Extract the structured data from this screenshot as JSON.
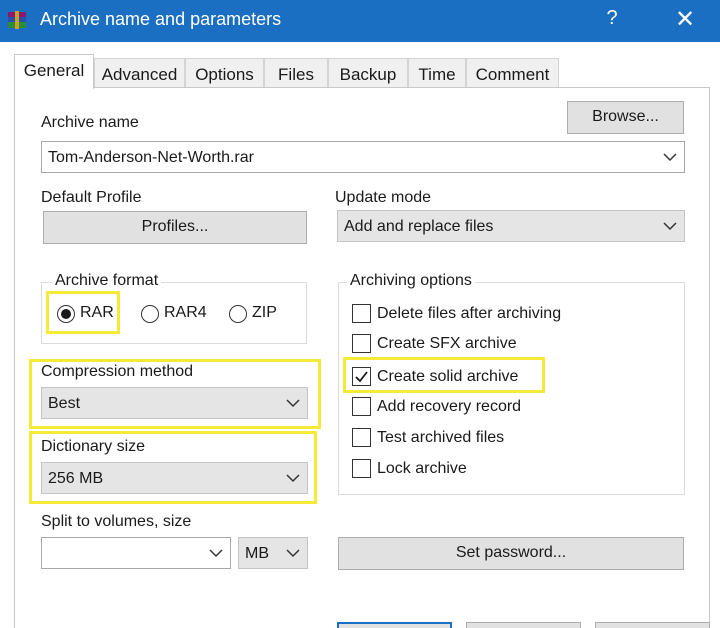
{
  "window": {
    "title": "Archive name and parameters",
    "help": "?",
    "close": "✕"
  },
  "tabs": [
    "General",
    "Advanced",
    "Options",
    "Files",
    "Backup",
    "Time",
    "Comment"
  ],
  "archive_name": {
    "label": "Archive name",
    "value": "Tom-Anderson-Net-Worth.rar",
    "browse": "Browse..."
  },
  "profile": {
    "label": "Default Profile",
    "button": "Profiles..."
  },
  "update_mode": {
    "label": "Update mode",
    "value": "Add and replace files"
  },
  "archive_format": {
    "label": "Archive format",
    "options": [
      "RAR",
      "RAR4",
      "ZIP"
    ],
    "selected": "RAR"
  },
  "compression": {
    "label": "Compression method",
    "value": "Best"
  },
  "dictionary": {
    "label": "Dictionary size",
    "value": "256 MB"
  },
  "split": {
    "label": "Split to volumes, size",
    "value": "",
    "unit": "MB"
  },
  "archiving_options": {
    "label": "Archiving options",
    "items": [
      {
        "label": "Delete files after archiving",
        "checked": false
      },
      {
        "label": "Create SFX archive",
        "checked": false
      },
      {
        "label": "Create solid archive",
        "checked": true
      },
      {
        "label": "Add recovery record",
        "checked": false
      },
      {
        "label": "Test archived files",
        "checked": false
      },
      {
        "label": "Lock archive",
        "checked": false
      }
    ]
  },
  "set_password": "Set password...",
  "highlight_color": "#f5ea35",
  "titlebar_color": "#1a6fc2"
}
